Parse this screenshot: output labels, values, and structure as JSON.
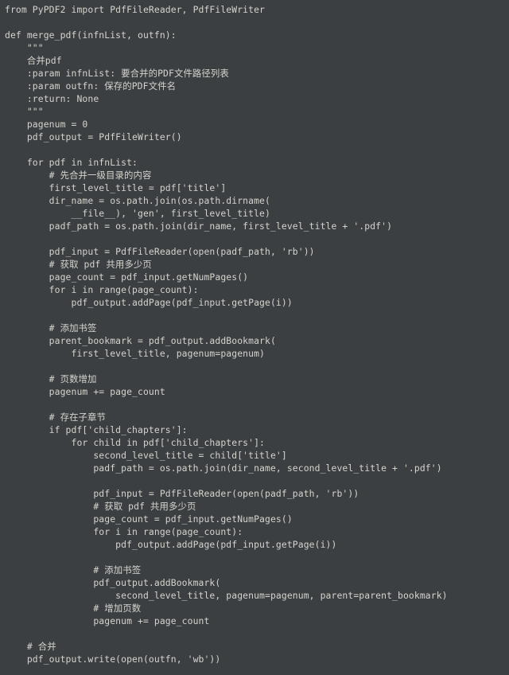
{
  "code": {
    "lang": "python",
    "theme": "dark",
    "lines": [
      "from PyPDF2 import PdfFileReader, PdfFileWriter",
      "",
      "def merge_pdf(infnList, outfn):",
      "    \"\"\"",
      "    合并pdf",
      "    :param infnList: 要合并的PDF文件路径列表",
      "    :param outfn: 保存的PDF文件名",
      "    :return: None",
      "    \"\"\"",
      "    pagenum = 0",
      "    pdf_output = PdfFileWriter()",
      "",
      "    for pdf in infnList:",
      "        # 先合并一级目录的内容",
      "        first_level_title = pdf['title']",
      "        dir_name = os.path.join(os.path.dirname(",
      "            __file__), 'gen', first_level_title)",
      "        padf_path = os.path.join(dir_name, first_level_title + '.pdf')",
      "",
      "        pdf_input = PdfFileReader(open(padf_path, 'rb'))",
      "        # 获取 pdf 共用多少页",
      "        page_count = pdf_input.getNumPages()",
      "        for i in range(page_count):",
      "            pdf_output.addPage(pdf_input.getPage(i))",
      "",
      "        # 添加书签",
      "        parent_bookmark = pdf_output.addBookmark(",
      "            first_level_title, pagenum=pagenum)",
      "",
      "        # 页数增加",
      "        pagenum += page_count",
      "",
      "        # 存在子章节",
      "        if pdf['child_chapters']:",
      "            for child in pdf['child_chapters']:",
      "                second_level_title = child['title']",
      "                padf_path = os.path.join(dir_name, second_level_title + '.pdf')",
      "",
      "                pdf_input = PdfFileReader(open(padf_path, 'rb'))",
      "                # 获取 pdf 共用多少页",
      "                page_count = pdf_input.getNumPages()",
      "                for i in range(page_count):",
      "                    pdf_output.addPage(pdf_input.getPage(i))",
      "",
      "                # 添加书签",
      "                pdf_output.addBookmark(",
      "                    second_level_title, pagenum=pagenum, parent=parent_bookmark)",
      "                # 增加页数",
      "                pagenum += page_count",
      "",
      "    # 合并",
      "    pdf_output.write(open(outfn, 'wb'))"
    ]
  }
}
